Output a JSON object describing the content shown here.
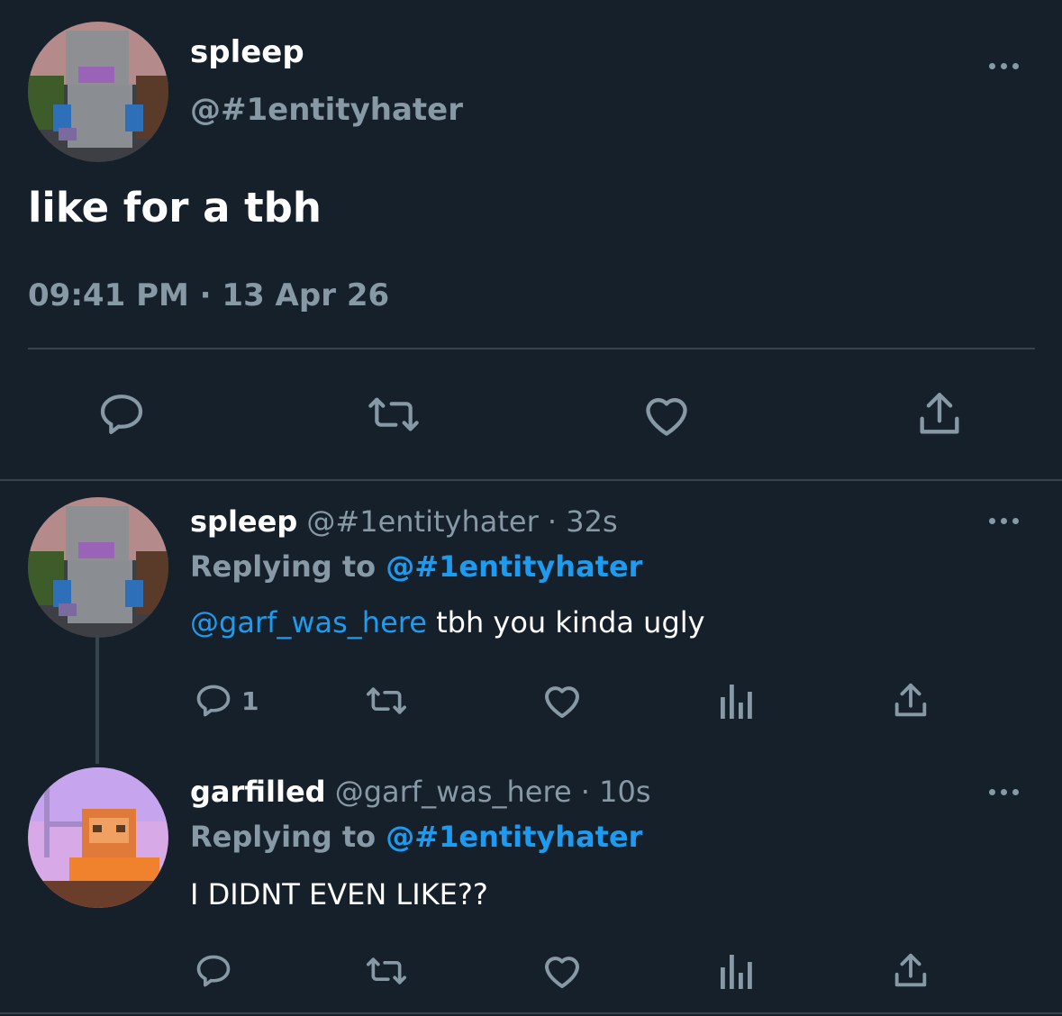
{
  "main_tweet": {
    "name": "spleep",
    "handle": "@#1entityhater",
    "text": "like for a tbh",
    "timestamp": "09:41 PM · 13 Apr 26",
    "actions": [
      "reply-icon",
      "retweet-icon",
      "like-icon",
      "share-icon"
    ]
  },
  "replies": [
    {
      "name": "spleep",
      "meta": "@#1entityhater · 32s",
      "replying_prefix": "Replying to",
      "replying_handle": "@#1entityhater",
      "mention": "@garf_was_here",
      "text": " tbh you kinda ugly",
      "reply_count": "1"
    },
    {
      "name": "garfilled",
      "meta": "@garf_was_here · 10s",
      "replying_prefix": "Replying to",
      "replying_handle": "@#1entityhater",
      "text": "I DIDNT EVEN LIKE??"
    }
  ],
  "colors": {
    "background": "#15202b",
    "muted": "#8899a6",
    "accent": "#1d9bf0",
    "divider": "#38444d"
  }
}
